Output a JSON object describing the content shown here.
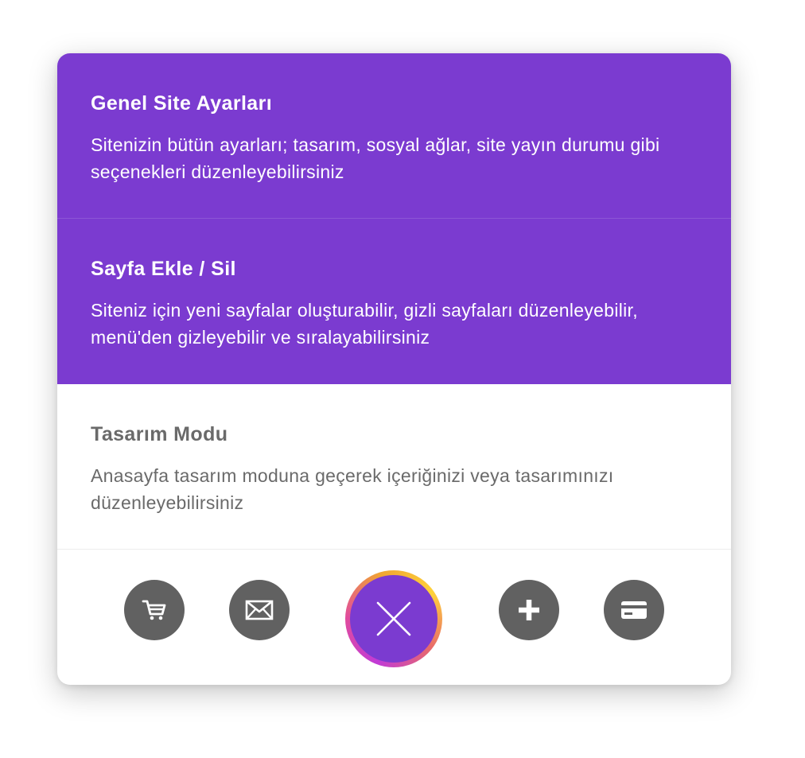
{
  "menu": {
    "items": [
      {
        "title": "Genel Site Ayarları",
        "description": "Sitenizin bütün ayarları; tasarım, sosyal ağlar, site yayın durumu gibi seçenekleri düzenleyebilirsiniz",
        "state": "active"
      },
      {
        "title": "Sayfa Ekle / Sil",
        "description": "Siteniz için yeni sayfalar oluşturabilir, gizli sayfaları düzenleyebilir, menü'den gizleyebilir ve sıralayabilirsiniz",
        "state": "active"
      },
      {
        "title": "Tasarım Modu",
        "description": "Anasayfa tasarım moduna geçerek içeriğinizi veya tasarımınızı düzenleyebilirsiniz",
        "state": "inactive"
      }
    ]
  },
  "toolbar": {
    "buttons": [
      {
        "icon": "cart-icon"
      },
      {
        "icon": "envelope-icon"
      },
      {
        "icon": "close-icon",
        "primary": true
      },
      {
        "icon": "plus-icon"
      },
      {
        "icon": "credit-card-icon"
      }
    ]
  },
  "colors": {
    "accent": "#7b3bd0",
    "button_gray": "#616161",
    "inactive_text": "#6a6a6a",
    "ring_gradient": [
      "#c13bd6",
      "#e14c9c",
      "#f0a532",
      "#ffd23a"
    ]
  }
}
